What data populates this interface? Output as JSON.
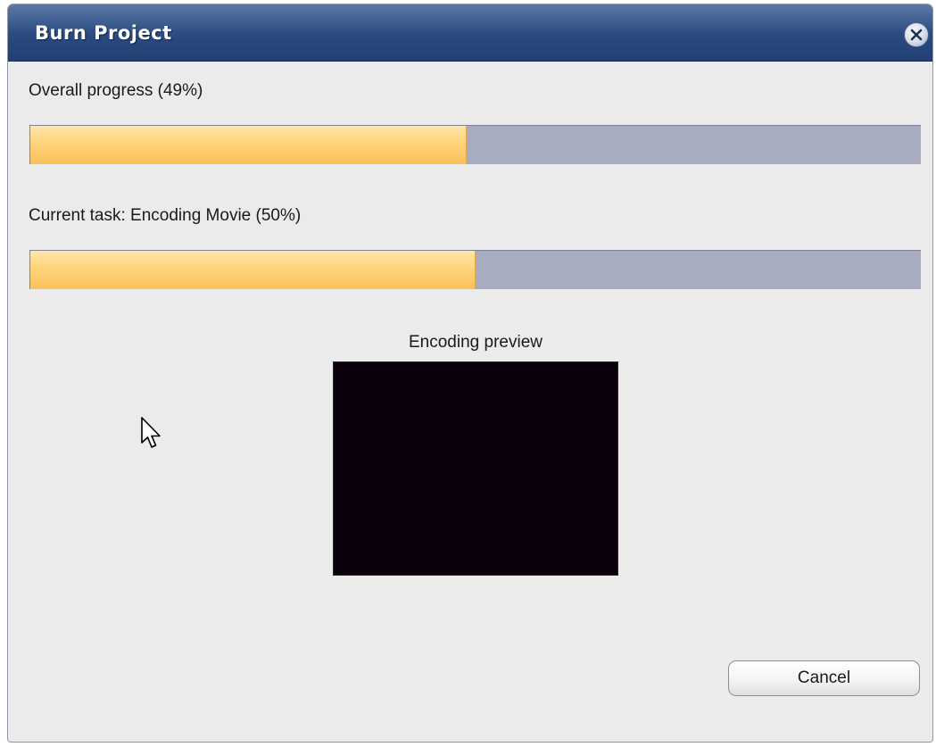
{
  "window": {
    "title": "Burn Project",
    "close_icon": "close-icon"
  },
  "overall": {
    "label": "Overall progress (49%)",
    "percent": 49
  },
  "current_task": {
    "label": "Current task: Encoding Movie  (50%)",
    "percent": 50
  },
  "preview": {
    "label": "Encoding preview",
    "background": "#0c000d"
  },
  "buttons": {
    "cancel_label": "Cancel"
  },
  "colors": {
    "title_bar": "#2a4a80",
    "progress_fill": "#ffd47a",
    "progress_track": "#a7acc0",
    "dialog_bg": "#ebebeb"
  },
  "cursor_icon": "mouse-pointer-icon"
}
